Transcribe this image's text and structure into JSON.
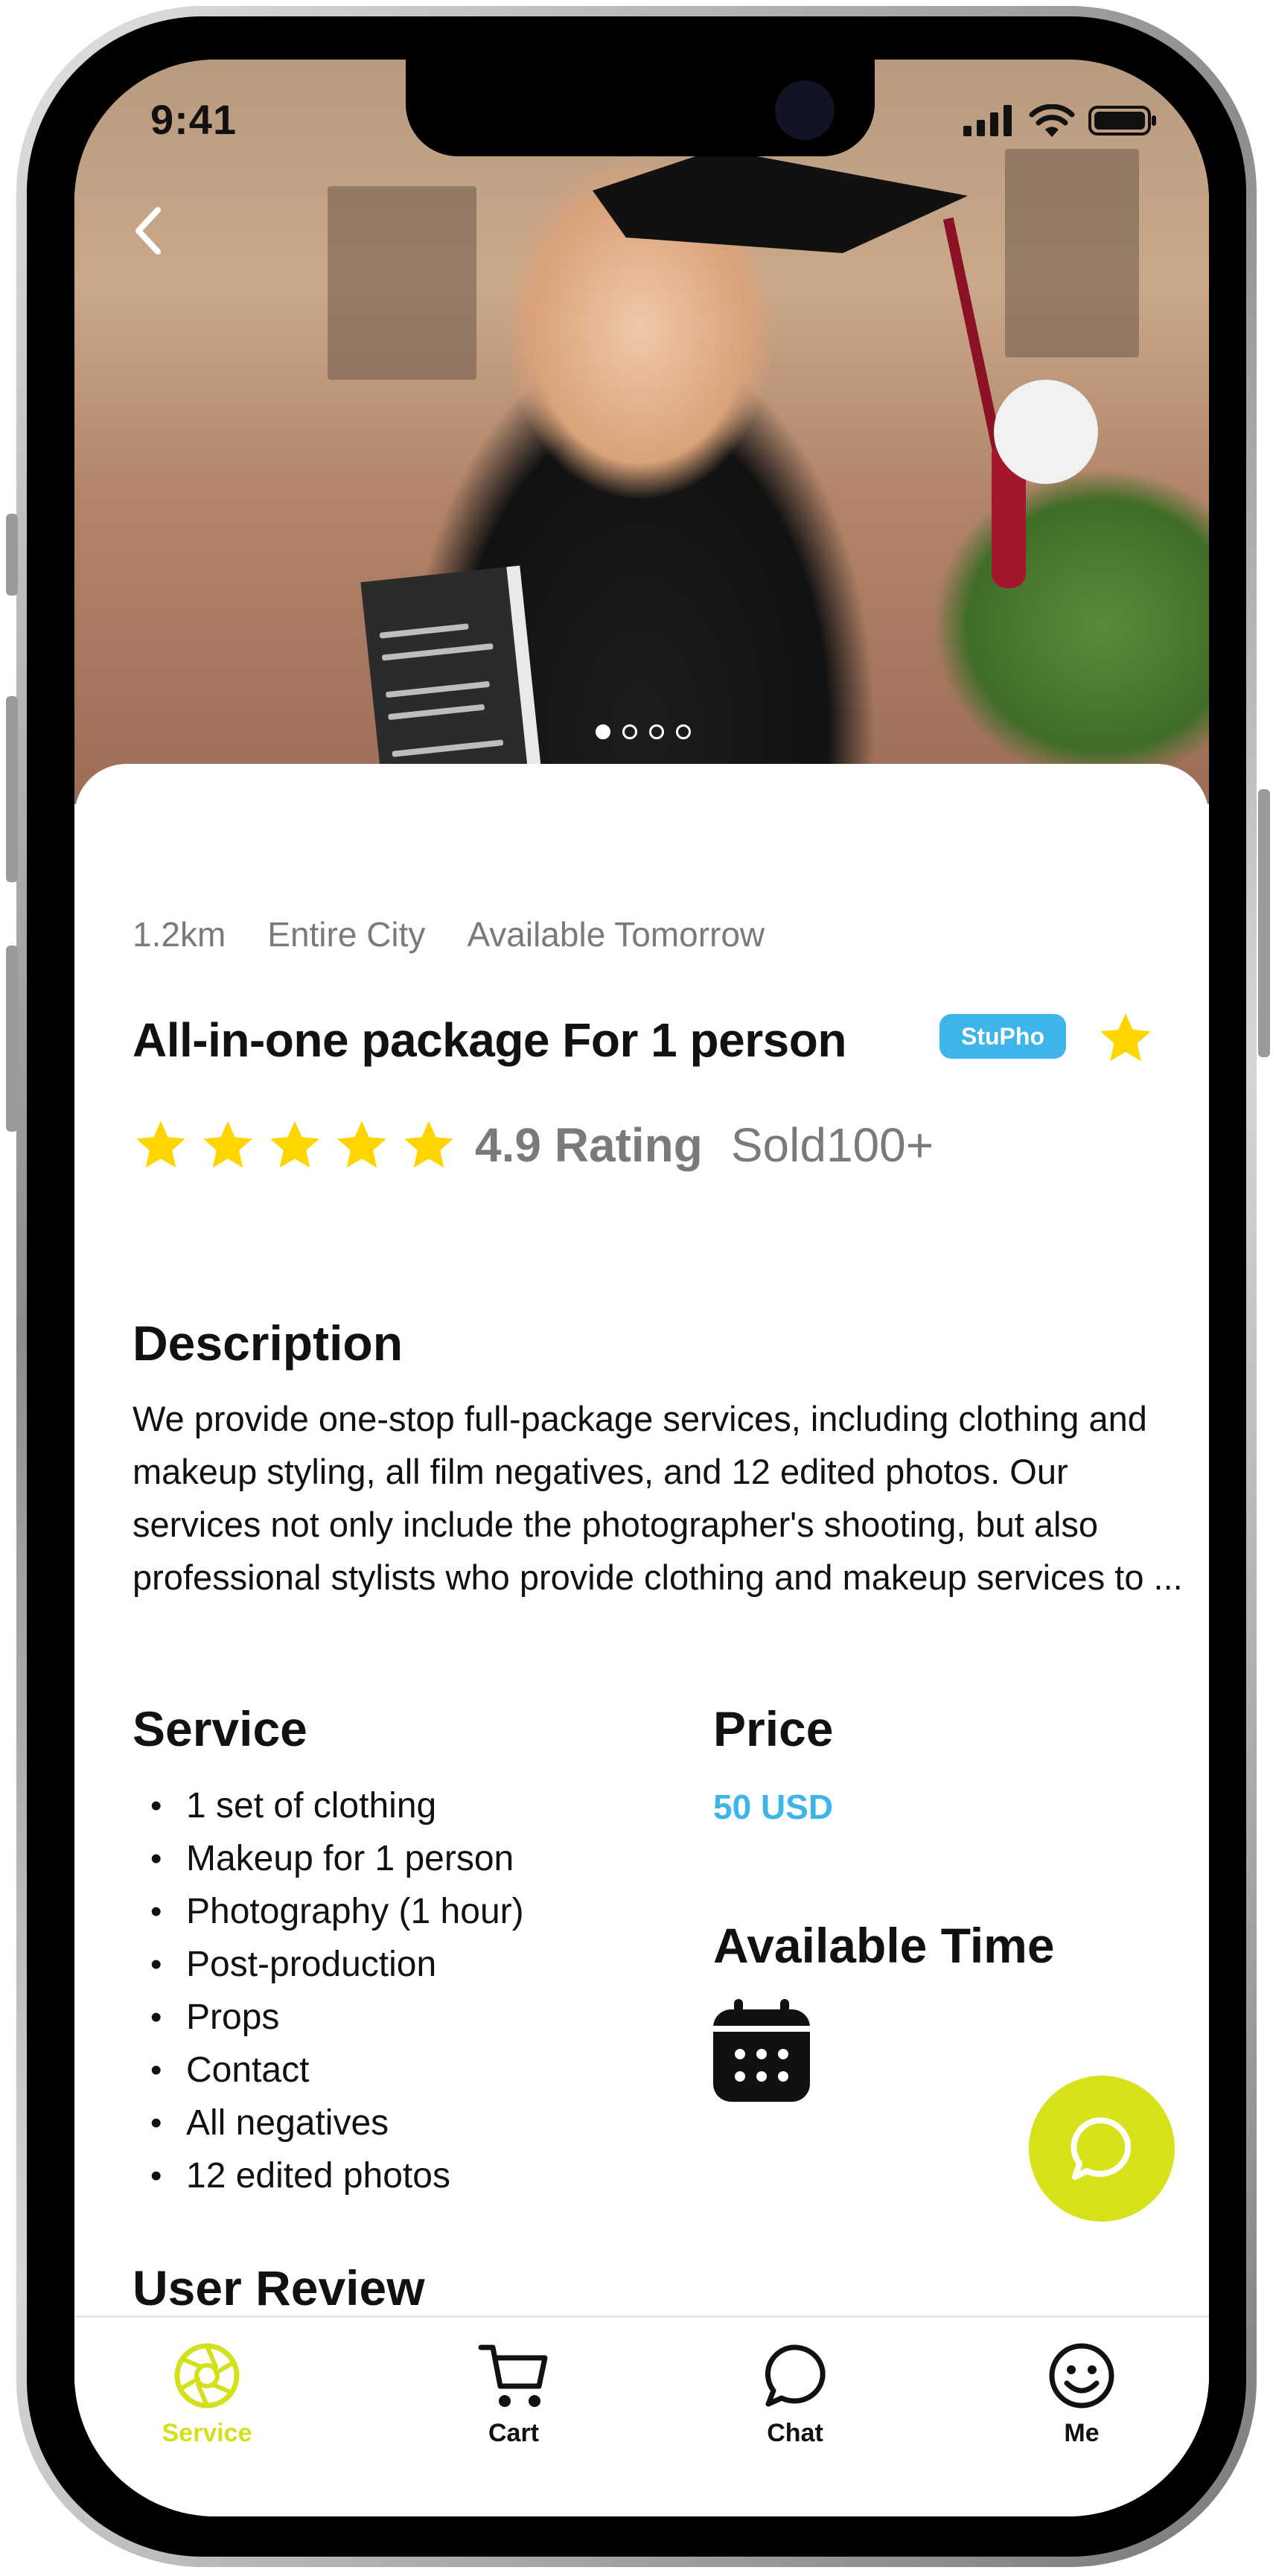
{
  "status_bar": {
    "time": "9:41"
  },
  "carousel": {
    "count": 4,
    "active_index": 0
  },
  "service": {
    "distance": "1.2km",
    "area": "Entire City",
    "availability": "Available Tomorrow",
    "title": "All-in-one package For 1 person",
    "badge": "StuPho",
    "rating_stars": 5,
    "rating_text": "4.9 Rating",
    "sold_text": "Sold100+"
  },
  "description": {
    "heading": "Description",
    "text": "We provide one-stop full-package services, including clothing and makeup styling, all film negatives, and 12 edited photos. Our services not only include the photographer's shooting, but also professional stylists who provide clothing and makeup services to ..."
  },
  "service_section": {
    "heading": "Service",
    "items": [
      "1 set of clothing",
      "Makeup for 1 person",
      "Photography (1 hour)",
      "Post-production",
      "Props",
      "Contact",
      "All negatives",
      "12 edited photos"
    ]
  },
  "price_section": {
    "heading": "Price",
    "value": "50 USD"
  },
  "available_time": {
    "heading": "Available Time",
    "icon": "calendar-icon"
  },
  "user_review": {
    "heading": "User Review"
  },
  "bottom_nav": [
    {
      "label": "Service",
      "icon": "camera-aperture-icon",
      "active": true
    },
    {
      "label": "Cart",
      "icon": "cart-icon",
      "active": false
    },
    {
      "label": "Chat",
      "icon": "chat-bubble-icon",
      "active": false
    },
    {
      "label": "Me",
      "icon": "smiley-icon",
      "active": false
    }
  ],
  "colors": {
    "accent_lime": "#d4e01a",
    "accent_blue": "#3db4ea",
    "star_yellow": "#ffd500",
    "muted_text": "#7a7a7a"
  }
}
